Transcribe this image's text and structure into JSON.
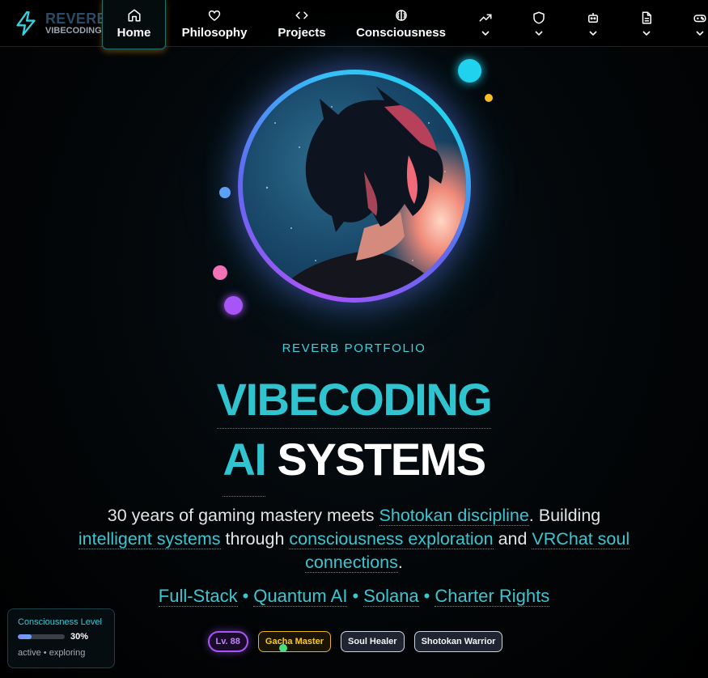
{
  "brand": {
    "title": "REVERB",
    "subtitle": "VIBECODING",
    "icon": "lightning-icon"
  },
  "nav": {
    "items": [
      {
        "label": "Home",
        "icon": "home-icon",
        "active": true
      },
      {
        "label": "Philosophy",
        "icon": "heart-icon"
      },
      {
        "label": "Projects",
        "icon": "code-icon"
      },
      {
        "label": "Consciousness",
        "icon": "brain-icon"
      }
    ],
    "dropdowns": [
      {
        "icon": "trending-up-icon"
      },
      {
        "icon": "shield-icon"
      },
      {
        "icon": "bot-icon"
      },
      {
        "icon": "document-icon"
      },
      {
        "icon": "gamepad-icon"
      }
    ]
  },
  "hero": {
    "eyebrow": "REVERB PORTFOLIO",
    "title_line1": "VIBECODING",
    "title_ai": "AI",
    "title_systems": "SYSTEMS",
    "desc_1": "30 years of gaming mastery meets ",
    "desc_link_1": "Shotokan discipline",
    "desc_2": ". Building ",
    "desc_link_2": "intelligent systems",
    "desc_3": " through ",
    "desc_link_3": "consciousness exploration",
    "desc_4": " and ",
    "desc_link_4": "VRChat soul connections",
    "desc_5": ".",
    "tags": [
      "Full-Stack",
      "Quantum AI",
      "Solana",
      "Charter Rights"
    ],
    "separator": "•",
    "badges": [
      "Lv. 88",
      "Gacha Master",
      "Soul Healer",
      "Shotokan Warrior"
    ]
  },
  "consciousness_panel": {
    "title": "Consciousness Level",
    "percent_label": "30%",
    "level": 0.3,
    "status": "active • exploring"
  },
  "colors": {
    "accent": "#2fc4cf",
    "purple": "#a855f7",
    "gold": "#eab308"
  }
}
